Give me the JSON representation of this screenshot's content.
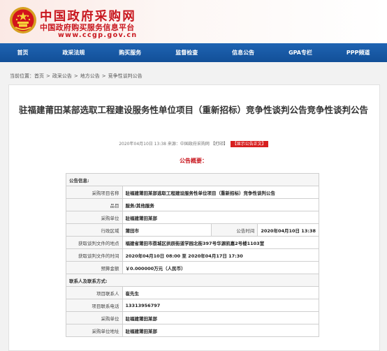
{
  "header": {
    "logo_cn": "中国政府采购网",
    "logo_sub": "中国政府购买服务信息平台",
    "logo_url": "www.ccgp.gov.cn"
  },
  "nav": {
    "items": [
      "首页",
      "政采法规",
      "购买服务",
      "监督检查",
      "信息公告",
      "GPA专栏",
      "PPP频道"
    ]
  },
  "breadcrumb": {
    "prefix": "当前位置：",
    "items": [
      "首页",
      "政采公告",
      "地方公告",
      "竞争性谈判公告"
    ]
  },
  "article": {
    "title": "驻福建莆田某部选取工程建设服务性单位项目（重新招标）竞争性谈判公告竞争性谈判公告",
    "meta": "2020年04月10日 13:38 来源：中国政府采购网",
    "print_label": "【打印】",
    "show_label": "【显示公告正文】",
    "summary_label": "公告概要："
  },
  "info": {
    "section1": "公告信息:",
    "rows": {
      "project_name_label": "采购项目名称",
      "project_name": "驻福建莆田某部选取工程建设服务性单位项目（重新招标）竞争性谈判公告",
      "item_label": "品目",
      "item": "服务/其他服务",
      "unit_label": "采购单位",
      "unit": "驻福建莆田某部",
      "region_label": "行政区域",
      "region": "莆田市",
      "pubtime_label": "公告时间",
      "pubtime": "2020年04月10日 13:38",
      "fileplace_label": "获取谈判文件的地点",
      "fileplace": "福建省莆田市荔城区拱辰街道学园北街397号华源凯嘉2号楼1103室",
      "filetime_label": "获取谈判文件的时间",
      "filetime": "2020年04月10日 08:00 至 2020年04月17日 17:30",
      "budget_label": "预算金额",
      "budget": "￥0.000000万元（人民币）"
    },
    "section2": "联系人及联系方式:",
    "contacts": {
      "contact_label": "项目联系人",
      "contact": "崔先生",
      "phone_label": "项目联系电话",
      "phone": "13313956797",
      "unit_label": "采购单位",
      "unit": "驻福建莆田某部",
      "addr_label": "采购单位地址",
      "addr": "驻福建莆田某部"
    }
  },
  "colors": {
    "brand_red": "#c8161e",
    "nav_blue": "#1a5aa8"
  }
}
